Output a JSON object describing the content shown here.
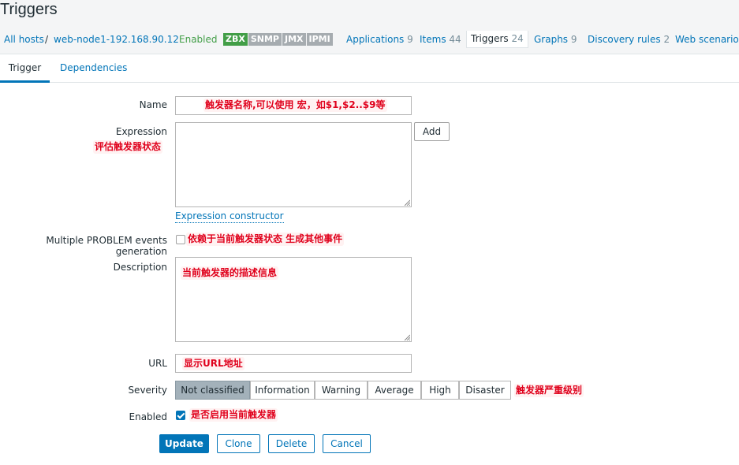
{
  "page": {
    "title": "Triggers"
  },
  "breadcrumbs": {
    "all_hosts": "All hosts",
    "separator": "/",
    "host": "web-node1-192.168.90.12",
    "status": "Enabled",
    "availability": [
      "ZBX",
      "SNMP",
      "JMX",
      "IPMI"
    ],
    "tabs": [
      {
        "label": "Applications",
        "count": "9"
      },
      {
        "label": "Items",
        "count": "44"
      },
      {
        "label": "Triggers",
        "count": "24"
      },
      {
        "label": "Graphs",
        "count": "9"
      },
      {
        "label": "Discovery rules",
        "count": "2"
      },
      {
        "label": "Web scenarios",
        "count": ""
      }
    ]
  },
  "subtabs": [
    "Trigger",
    "Dependencies"
  ],
  "form": {
    "name_label": "Name",
    "name_value": "",
    "expression_label": "Expression",
    "expression_value": "",
    "add_button": "Add",
    "expression_constructor": "Expression constructor",
    "multiple_problem_label": "Multiple PROBLEM events generation",
    "description_label": "Description",
    "description_value": "",
    "url_label": "URL",
    "url_value": "",
    "severity_label": "Severity",
    "severity_options": [
      "Not classified",
      "Information",
      "Warning",
      "Average",
      "High",
      "Disaster"
    ],
    "severity_selected": "Not classified",
    "enabled_label": "Enabled"
  },
  "buttons": {
    "update": "Update",
    "clone": "Clone",
    "delete": "Delete",
    "cancel": "Cancel"
  },
  "annotations": {
    "name": "触发器名称,可以使用 宏，如$1,$2..$9等",
    "expression": "评估触发器状态",
    "multiple": "依赖于当前触发器状态 生成其他事件",
    "description": "当前触发器的描述信息",
    "url": "显示URL地址",
    "severity": "触发器严重级别",
    "enabled": "是否启用当前触发器"
  },
  "colors": {
    "accent": "#0275b8",
    "enabled": "#429e47",
    "annotation": "#e0001b",
    "selected_severity": "#a3b1ba"
  }
}
